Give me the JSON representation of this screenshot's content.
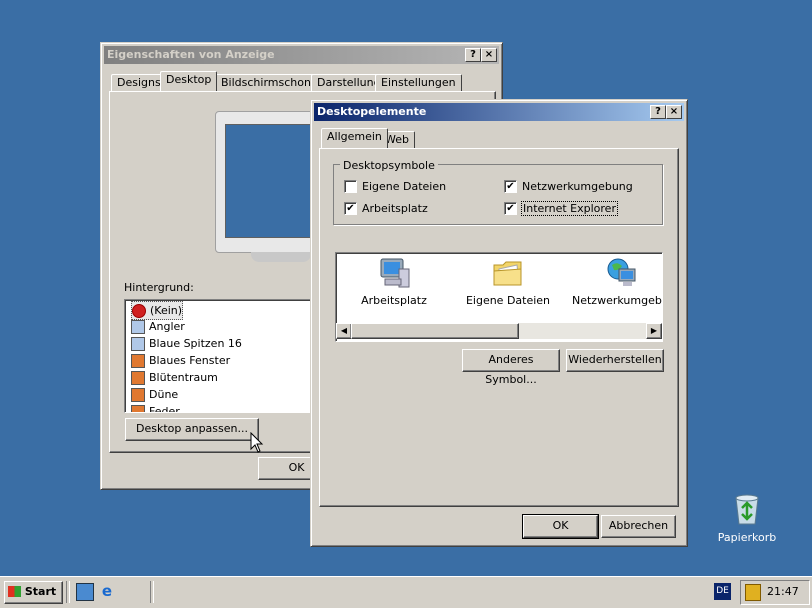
{
  "desktop": {
    "recycle_bin_label": "Papierkorb"
  },
  "display_props": {
    "title": "Eigenschaften von Anzeige",
    "help_btn": "?",
    "close_btn": "×",
    "tabs": [
      "Designs",
      "Desktop",
      "Bildschirmschoner",
      "Darstellung",
      "Einstellungen"
    ],
    "background_label": "Hintergrund:",
    "backgrounds": [
      "(Kein)",
      "Angler",
      "Blaue Spitzen 16",
      "Blaues Fenster",
      "Blütentraum",
      "Düne",
      "Feder"
    ],
    "customize_btn": "Desktop anpassen...",
    "ok_btn": "OK"
  },
  "desktop_items": {
    "title": "Desktopelemente",
    "help_btn": "?",
    "close_btn": "×",
    "tabs": [
      "Allgemein",
      "Web"
    ],
    "group_label": "Desktopsymbole",
    "checkboxes": [
      {
        "label": "Eigene Dateien",
        "checked": false
      },
      {
        "label": "Netzwerkumgebung",
        "checked": true
      },
      {
        "label": "Arbeitsplatz",
        "checked": true
      },
      {
        "label": "Internet Explorer",
        "checked": true
      }
    ],
    "check_mark": "✔",
    "icons": [
      "Arbeitsplatz",
      "Eigene Dateien",
      "Netzwerkumgebung"
    ],
    "change_icon_btn": "Anderes Symbol...",
    "restore_btn": "Wiederherstellen",
    "ok_btn": "OK",
    "cancel_btn": "Abbrechen"
  },
  "taskbar": {
    "start_label": "Start",
    "lang": "DE",
    "time": "21:47"
  }
}
